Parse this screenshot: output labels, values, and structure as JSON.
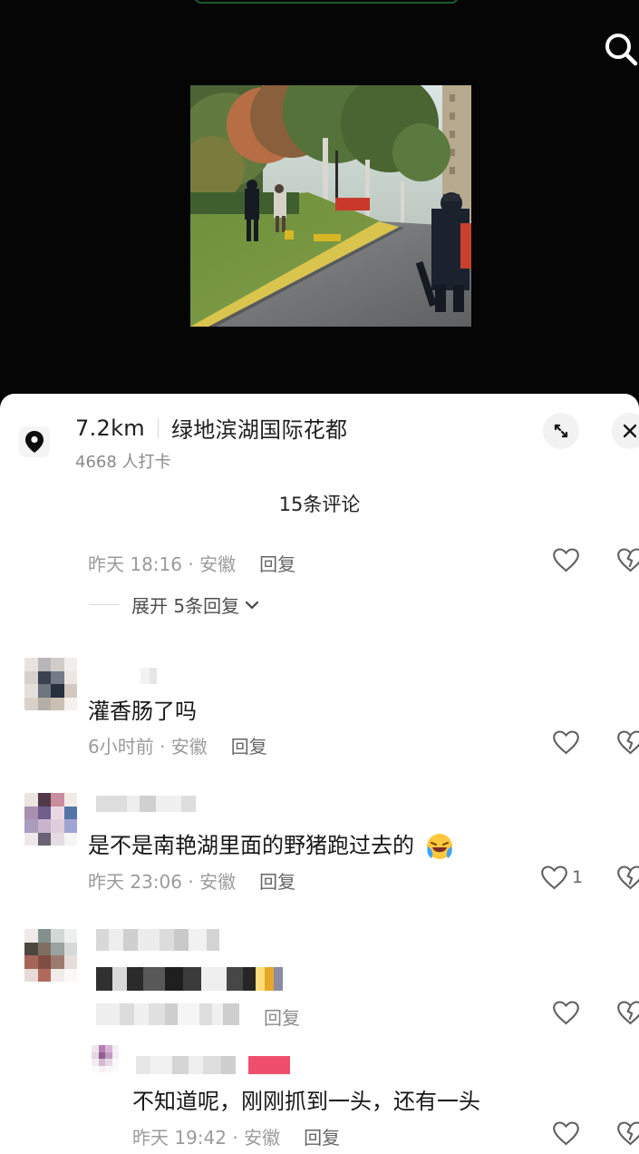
{
  "location": {
    "distance": "7.2km",
    "name": "绿地滨湖国际花都",
    "checkins": "4668 人打卡"
  },
  "comments_header": {
    "count_label": "15条评论"
  },
  "comments": [
    {
      "time_region": "昨天 18:16 · 安徽",
      "reply_label": "回复",
      "expand_label": "展开 5条回复"
    },
    {
      "text": "灌香肠了吗",
      "time_region": "6小时前 · 安徽",
      "reply_label": "回复"
    },
    {
      "text": "是不是南艳湖里面的野猪跑过去的",
      "time_region": "昨天 23:06 · 安徽",
      "reply_label": "回复",
      "like_count": "1"
    },
    {
      "reply_label": "回复"
    },
    {
      "text": "不知道呢，刚刚抓到一头，还有一头",
      "time_region": "昨天 19:42 · 安徽",
      "reply_label": "回复"
    }
  ],
  "icons": {
    "search": "search-icon",
    "location": "location-pin-icon",
    "expand": "expand-icon",
    "close": "close-icon",
    "like": "heart-icon",
    "dislike": "broken-heart-icon",
    "chevron": "chevron-down-icon"
  }
}
